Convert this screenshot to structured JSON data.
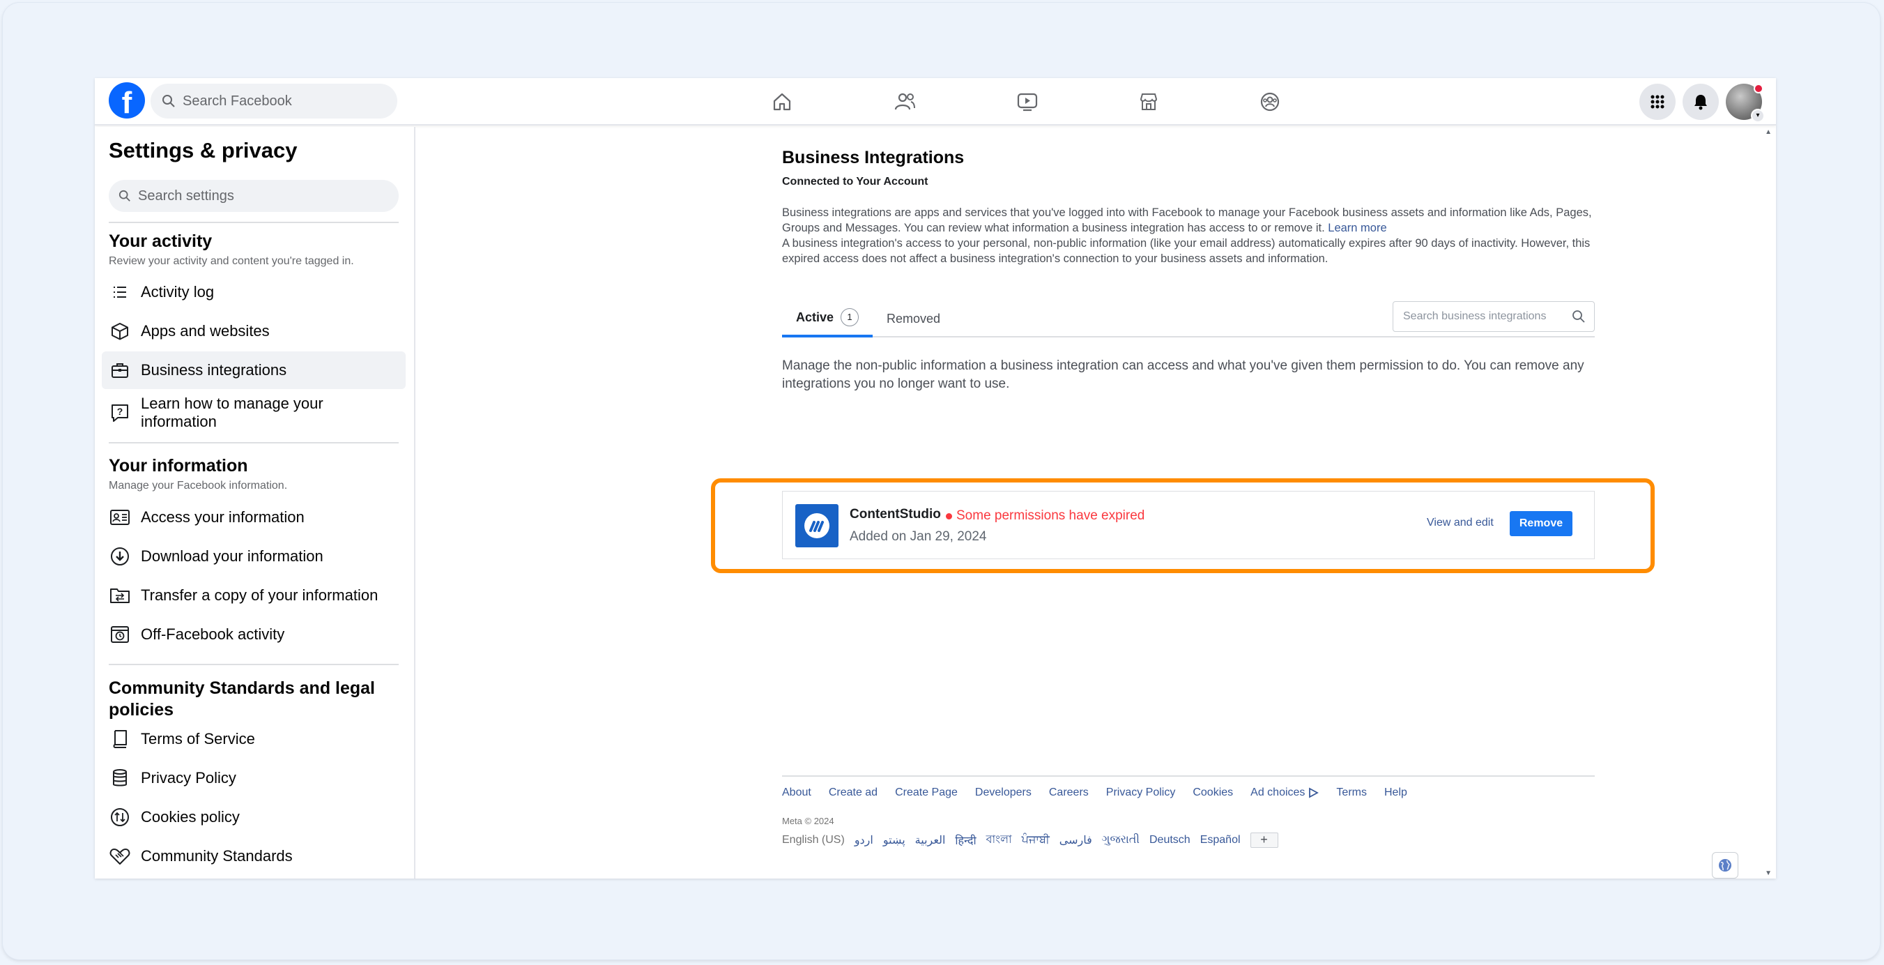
{
  "topbar": {
    "logo": "f",
    "search_placeholder": "Search Facebook",
    "nav_icons": [
      "home-icon",
      "friends-icon",
      "video-icon",
      "marketplace-icon",
      "groups-icon"
    ],
    "right_icons": [
      "menu-grid-icon",
      "notifications-bell-icon",
      "account-avatar"
    ]
  },
  "sidebar": {
    "title": "Settings & privacy",
    "search_placeholder": "Search settings",
    "sections": [
      {
        "title": "Your activity",
        "subtitle": "Review your activity and content you're tagged in.",
        "items": [
          {
            "label": "Activity log",
            "icon": "list-icon"
          },
          {
            "label": "Apps and websites",
            "icon": "cube-icon"
          },
          {
            "label": "Business integrations",
            "icon": "briefcase-icon",
            "active": true
          },
          {
            "label": "Learn how to manage your information",
            "icon": "help-bubble-icon"
          }
        ]
      },
      {
        "title": "Your information",
        "subtitle": "Manage your Facebook information.",
        "items": [
          {
            "label": "Access your information",
            "icon": "id-card-icon"
          },
          {
            "label": "Download your information",
            "icon": "download-icon"
          },
          {
            "label": "Transfer a copy of your information",
            "icon": "transfer-folder-icon"
          },
          {
            "label": "Off-Facebook activity",
            "icon": "history-icon"
          }
        ]
      },
      {
        "title": "Community Standards and legal policies",
        "subtitle": "",
        "items": [
          {
            "label": "Terms of Service",
            "icon": "book-icon"
          },
          {
            "label": "Privacy Policy",
            "icon": "database-icon"
          },
          {
            "label": "Cookies policy",
            "icon": "cookie-icon"
          },
          {
            "label": "Community Standards",
            "icon": "handshake-icon"
          }
        ]
      }
    ]
  },
  "main": {
    "title": "Business Integrations",
    "subtitle": "Connected to Your Account",
    "para1": "Business integrations are apps and services that you've logged into with Facebook to manage your Facebook business assets and information like Ads, Pages, Groups and Messages. You can review what information a business integration has access to or remove it.",
    "para1_link": "Learn more",
    "para2": "A business integration's access to your personal, non-public information (like your email address) automatically expires after 90 days of inactivity. However, this expired access does not affect a business integration's connection to your business assets and information.",
    "tabs": {
      "active_label": "Active",
      "active_count": "1",
      "removed_label": "Removed"
    },
    "search_placeholder": "Search business integrations",
    "manage_text": "Manage the non-public information a business integration can access and what you've given them permission to do. You can remove any integrations you no longer want to use.",
    "integration": {
      "name": "ContentStudio",
      "warning": "Some permissions have expired",
      "added": "Added on Jan 29, 2024",
      "view_edit": "View and edit",
      "remove": "Remove"
    },
    "footer": {
      "links": [
        "About",
        "Create ad",
        "Create Page",
        "Developers",
        "Careers",
        "Privacy Policy",
        "Cookies",
        "Ad choices",
        "Terms",
        "Help"
      ],
      "meta": "Meta © 2024",
      "current_language": "English (US)",
      "languages": [
        "اردو",
        "پښتو",
        "العربية",
        "हिन्दी",
        "বাংলা",
        "ਪੰਜਾਬੀ",
        "فارسی",
        "ગુજરાતી",
        "Deutsch",
        "Español"
      ],
      "more": "+"
    }
  },
  "colors": {
    "brand": "#0866ff",
    "accent": "#1877f2",
    "warning": "#fa383e",
    "highlight": "#ff8c00"
  }
}
